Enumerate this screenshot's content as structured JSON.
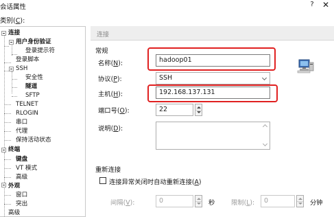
{
  "window": {
    "title": "会话属性",
    "help": "?",
    "close": "✕"
  },
  "category_label": "类别",
  "category_hotkey": "C",
  "category_suffix": "):",
  "tree": [
    {
      "label": "连接",
      "bold": true
    },
    {
      "label": "用户身份验证",
      "bold": true
    },
    {
      "label": "登录提示符"
    },
    {
      "label": "登录脚本"
    },
    {
      "label": "SSH"
    },
    {
      "label": "安全性"
    },
    {
      "label": "隧道",
      "bold": true
    },
    {
      "label": "SFTP"
    },
    {
      "label": "TELNET"
    },
    {
      "label": "RLOGIN"
    },
    {
      "label": "串口"
    },
    {
      "label": "代理"
    },
    {
      "label": "保持活动状态"
    },
    {
      "label": "终端",
      "bold": true
    },
    {
      "label": "键盘",
      "bold": true
    },
    {
      "label": "VT 模式"
    },
    {
      "label": "高级"
    },
    {
      "label": "外观",
      "bold": true
    },
    {
      "label": "窗口"
    },
    {
      "label": "突出"
    },
    {
      "label": "高级"
    }
  ],
  "panel": {
    "header": "连接",
    "general_section": "常规",
    "name_label": "名称(",
    "name_hotkey": "N",
    "name_value": "hadoop01",
    "protocol_label": "协议(",
    "protocol_hotkey": "P",
    "protocol_value": "SSH",
    "host_label": "主机(",
    "host_hotkey": "H",
    "host_value": "192.168.137.131",
    "port_label": "端口号(",
    "port_hotkey": "O",
    "port_value": "22",
    "desc_label": "说明(",
    "desc_hotkey": "D",
    "label_close": "):",
    "reconnect_section": "重新连接",
    "reconnect_checkbox": "连接异常关闭时自动重新连接(",
    "reconnect_hotkey": "A",
    "reconnect_close": ")",
    "interval_label": "间隔(",
    "interval_hotkey": "V",
    "interval_value": "0",
    "interval_unit": "秒",
    "limit_label": "限制(",
    "limit_hotkey": "L",
    "limit_value": "0",
    "limit_unit": "分钟"
  },
  "colors": {
    "highlight": "#e02020",
    "header_bg": "#eeeeee"
  }
}
